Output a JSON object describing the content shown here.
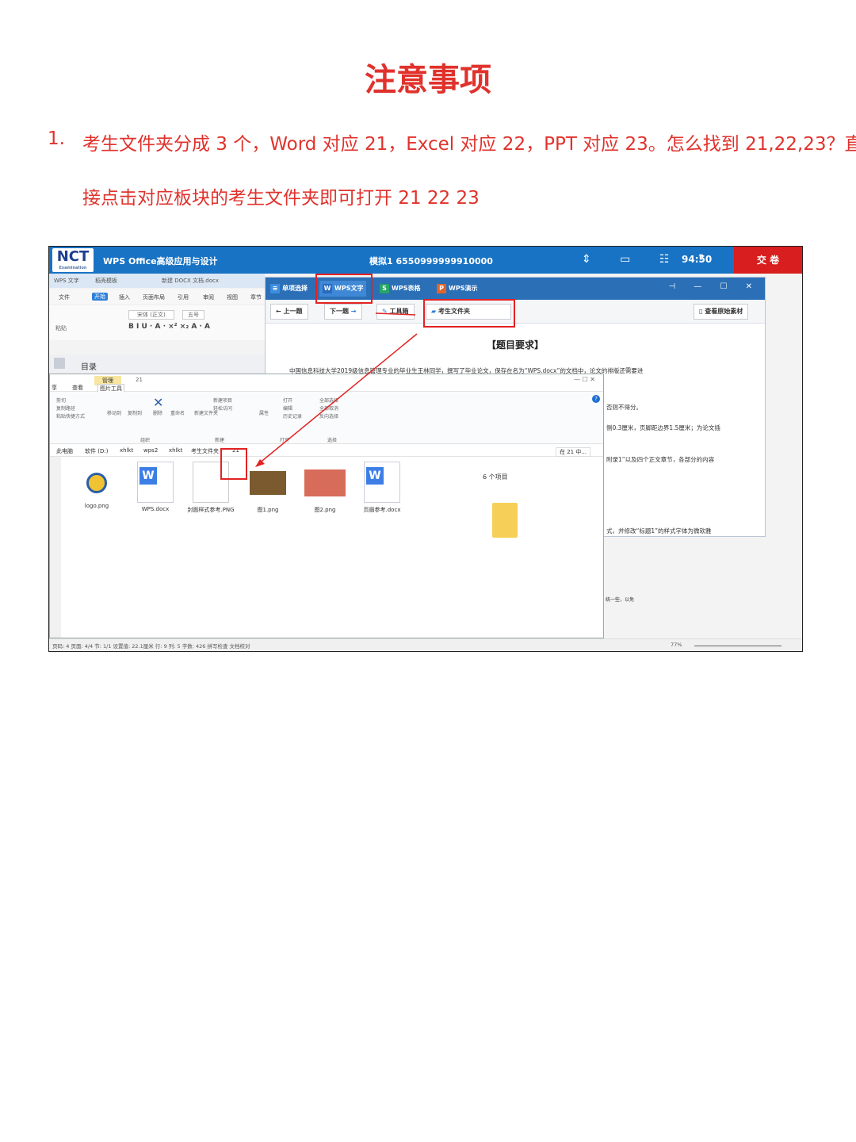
{
  "doc": {
    "title": "注意事项",
    "item_num": "1.",
    "item_line1": "考生文件夹分成 3 个，Word 对应 21，Excel 对应 22，PPT 对应 23。怎么找到 21,22,23？直",
    "item_line2": "接点击对应板块的考生文件夹即可打开 21    22    23"
  },
  "exam": {
    "logo": "NCT",
    "logo_sub": "Examination",
    "app_title": "WPS Office高级应用与设计",
    "mock": "模拟1  6550999999910000",
    "icons": "⇕ ▭ ☷ ?",
    "time": "94:50",
    "submit": "交 卷"
  },
  "wps": {
    "tab_writer": "WPS 文字",
    "tab_template": "稻壳模板",
    "tab_doc": "新建 DOCX 文档.docx",
    "menu": [
      "文件",
      "开始",
      "插入",
      "页面布局",
      "引用",
      "审阅",
      "视图",
      "章节"
    ],
    "font": "宋体 (正文)",
    "size": "五号",
    "paste": "粘贴",
    "nav_label": "目录"
  },
  "question": {
    "tabs": [
      "单项选择",
      "WPS文字",
      "WPS表格",
      "WPS演示"
    ],
    "prev": "上一题",
    "next": "下一题",
    "toolbox": "工具箱",
    "exam_folder": "考生文件夹",
    "view_material": "查看原始素材",
    "heading": "【题目要求】",
    "body1": "中国信息科技大学2019级信息管理专业的毕业生王林同学，撰写了毕业论文，保存在名为“WPS.docx”的文档中，论文的排版还需要进",
    "frag1": "否则不得分。",
    "frag2": "侧0.3厘米，页脚距边界1.5厘米；为论文插",
    "frag3": "附录1”以及四个正文章节，各部分的内容",
    "frag4": "式，并修改“标题1”的样式字体为微软雅",
    "frag5": "统一些，以免"
  },
  "explorer": {
    "manage": "管理",
    "folder_num": "21",
    "tabs": [
      "享",
      "查看",
      "图片工具"
    ],
    "ribbon": [
      "剪切",
      "复制路径",
      "粘贴快捷方式",
      "移动到",
      "复制到",
      "删除",
      "重命名",
      "新建文件夹",
      "新建项目",
      "轻松访问",
      "属性",
      "打开",
      "编辑",
      "历史记录",
      "全部选择",
      "全部取消",
      "反向选择",
      "组织",
      "新建",
      "打开",
      "选择"
    ],
    "path": [
      "此电脑",
      "软件 (D:)",
      "xhlkt",
      "wps2",
      "xhlkt",
      "考生文件夹",
      "21"
    ],
    "search": "在 21 中...",
    "count": "6 个项目",
    "files": [
      "logo.png",
      "WPS.docx",
      "封面样式参考.PNG",
      "图1.png",
      "图2.png",
      "页眉参考.docx"
    ]
  },
  "status": {
    "text": "页码: 4   页面: 4/4   节: 1/1   设置值: 22.1厘米   行: 9   列: 5   字数: 426   拼写检查   文档校对",
    "zoom": "77%"
  },
  "colors": {
    "accent_red": "#e0322c",
    "exam_blue": "#1873c4",
    "submit_red": "#d81e1e"
  }
}
